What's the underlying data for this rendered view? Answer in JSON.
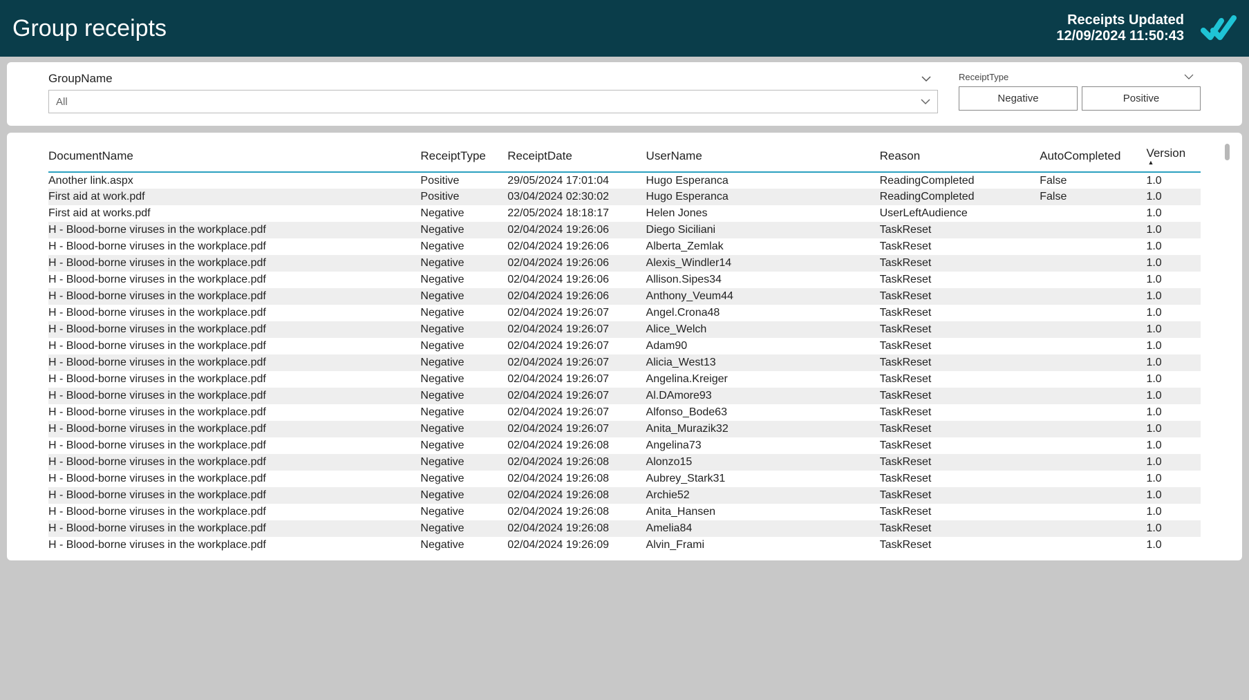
{
  "header": {
    "title": "Group receipts",
    "status_title": "Receipts Updated",
    "status_time": "12/09/2024 11:50:43"
  },
  "filters": {
    "group_label": "GroupName",
    "group_value": "All",
    "type_label": "ReceiptType",
    "type_options": {
      "negative": "Negative",
      "positive": "Positive"
    }
  },
  "columns": {
    "document": "DocumentName",
    "type": "ReceiptType",
    "date": "ReceiptDate",
    "user": "UserName",
    "reason": "Reason",
    "auto": "AutoCompleted",
    "version": "Version"
  },
  "rows": [
    {
      "doc": "Another link.aspx",
      "type": "Positive",
      "date": "29/05/2024 17:01:04",
      "user": "Hugo Esperanca",
      "reason": "ReadingCompleted",
      "auto": "False",
      "ver": "1.0"
    },
    {
      "doc": "First aid at work.pdf",
      "type": "Positive",
      "date": "03/04/2024 02:30:02",
      "user": "Hugo Esperanca",
      "reason": "ReadingCompleted",
      "auto": "False",
      "ver": "1.0"
    },
    {
      "doc": "First aid at works.pdf",
      "type": "Negative",
      "date": "22/05/2024 18:18:17",
      "user": "Helen Jones",
      "reason": "UserLeftAudience",
      "auto": "",
      "ver": "1.0"
    },
    {
      "doc": "H - Blood-borne viruses in the workplace.pdf",
      "type": "Negative",
      "date": "02/04/2024 19:26:06",
      "user": "Diego Siciliani",
      "reason": "TaskReset",
      "auto": "",
      "ver": "1.0"
    },
    {
      "doc": "H - Blood-borne viruses in the workplace.pdf",
      "type": "Negative",
      "date": "02/04/2024 19:26:06",
      "user": "Alberta_Zemlak",
      "reason": "TaskReset",
      "auto": "",
      "ver": "1.0"
    },
    {
      "doc": "H - Blood-borne viruses in the workplace.pdf",
      "type": "Negative",
      "date": "02/04/2024 19:26:06",
      "user": "Alexis_Windler14",
      "reason": "TaskReset",
      "auto": "",
      "ver": "1.0"
    },
    {
      "doc": "H - Blood-borne viruses in the workplace.pdf",
      "type": "Negative",
      "date": "02/04/2024 19:26:06",
      "user": "Allison.Sipes34",
      "reason": "TaskReset",
      "auto": "",
      "ver": "1.0"
    },
    {
      "doc": "H - Blood-borne viruses in the workplace.pdf",
      "type": "Negative",
      "date": "02/04/2024 19:26:06",
      "user": "Anthony_Veum44",
      "reason": "TaskReset",
      "auto": "",
      "ver": "1.0"
    },
    {
      "doc": "H - Blood-borne viruses in the workplace.pdf",
      "type": "Negative",
      "date": "02/04/2024 19:26:07",
      "user": "Angel.Crona48",
      "reason": "TaskReset",
      "auto": "",
      "ver": "1.0"
    },
    {
      "doc": "H - Blood-borne viruses in the workplace.pdf",
      "type": "Negative",
      "date": "02/04/2024 19:26:07",
      "user": "Alice_Welch",
      "reason": "TaskReset",
      "auto": "",
      "ver": "1.0"
    },
    {
      "doc": "H - Blood-borne viruses in the workplace.pdf",
      "type": "Negative",
      "date": "02/04/2024 19:26:07",
      "user": "Adam90",
      "reason": "TaskReset",
      "auto": "",
      "ver": "1.0"
    },
    {
      "doc": "H - Blood-borne viruses in the workplace.pdf",
      "type": "Negative",
      "date": "02/04/2024 19:26:07",
      "user": "Alicia_West13",
      "reason": "TaskReset",
      "auto": "",
      "ver": "1.0"
    },
    {
      "doc": "H - Blood-borne viruses in the workplace.pdf",
      "type": "Negative",
      "date": "02/04/2024 19:26:07",
      "user": "Angelina.Kreiger",
      "reason": "TaskReset",
      "auto": "",
      "ver": "1.0"
    },
    {
      "doc": "H - Blood-borne viruses in the workplace.pdf",
      "type": "Negative",
      "date": "02/04/2024 19:26:07",
      "user": "Al.DAmore93",
      "reason": "TaskReset",
      "auto": "",
      "ver": "1.0"
    },
    {
      "doc": "H - Blood-borne viruses in the workplace.pdf",
      "type": "Negative",
      "date": "02/04/2024 19:26:07",
      "user": "Alfonso_Bode63",
      "reason": "TaskReset",
      "auto": "",
      "ver": "1.0"
    },
    {
      "doc": "H - Blood-borne viruses in the workplace.pdf",
      "type": "Negative",
      "date": "02/04/2024 19:26:07",
      "user": "Anita_Murazik32",
      "reason": "TaskReset",
      "auto": "",
      "ver": "1.0"
    },
    {
      "doc": "H - Blood-borne viruses in the workplace.pdf",
      "type": "Negative",
      "date": "02/04/2024 19:26:08",
      "user": "Angelina73",
      "reason": "TaskReset",
      "auto": "",
      "ver": "1.0"
    },
    {
      "doc": "H - Blood-borne viruses in the workplace.pdf",
      "type": "Negative",
      "date": "02/04/2024 19:26:08",
      "user": "Alonzo15",
      "reason": "TaskReset",
      "auto": "",
      "ver": "1.0"
    },
    {
      "doc": "H - Blood-borne viruses in the workplace.pdf",
      "type": "Negative",
      "date": "02/04/2024 19:26:08",
      "user": "Aubrey_Stark31",
      "reason": "TaskReset",
      "auto": "",
      "ver": "1.0"
    },
    {
      "doc": "H - Blood-borne viruses in the workplace.pdf",
      "type": "Negative",
      "date": "02/04/2024 19:26:08",
      "user": "Archie52",
      "reason": "TaskReset",
      "auto": "",
      "ver": "1.0"
    },
    {
      "doc": "H - Blood-borne viruses in the workplace.pdf",
      "type": "Negative",
      "date": "02/04/2024 19:26:08",
      "user": "Anita_Hansen",
      "reason": "TaskReset",
      "auto": "",
      "ver": "1.0"
    },
    {
      "doc": "H - Blood-borne viruses in the workplace.pdf",
      "type": "Negative",
      "date": "02/04/2024 19:26:08",
      "user": "Amelia84",
      "reason": "TaskReset",
      "auto": "",
      "ver": "1.0"
    },
    {
      "doc": "H - Blood-borne viruses in the workplace.pdf",
      "type": "Negative",
      "date": "02/04/2024 19:26:09",
      "user": "Alvin_Frami",
      "reason": "TaskReset",
      "auto": "",
      "ver": "1.0"
    }
  ]
}
